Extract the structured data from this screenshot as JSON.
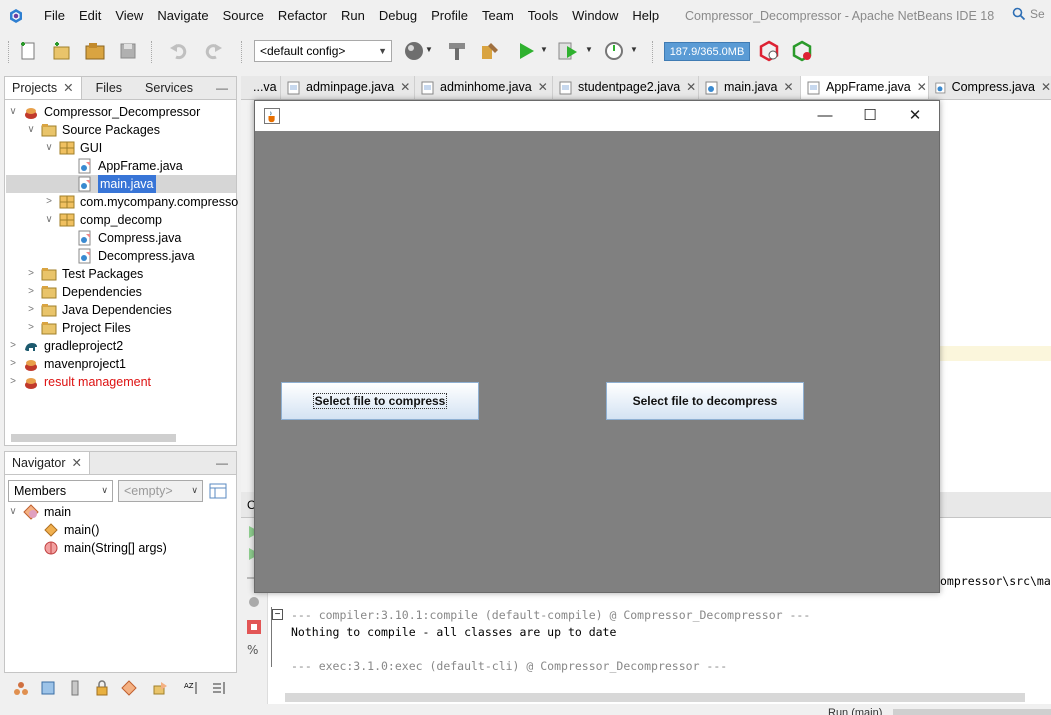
{
  "menubar": {
    "items": [
      "File",
      "Edit",
      "View",
      "Navigate",
      "Source",
      "Refactor",
      "Run",
      "Debug",
      "Profile",
      "Team",
      "Tools",
      "Window",
      "Help"
    ],
    "window_title": "Compressor_Decompressor - Apache NetBeans IDE 18",
    "search_text": "Se"
  },
  "toolbar": {
    "config": "<default config>",
    "memory": "187.9/365.0MB"
  },
  "projects_panel": {
    "tabs": [
      "Projects",
      "Files",
      "Services"
    ],
    "minimize": "—",
    "tree": [
      {
        "label": "Compressor_Decompressor",
        "chev": "∨",
        "icon": "maven-project-icon"
      },
      {
        "label": "Source Packages",
        "chev": "∨",
        "icon": "folder-icon"
      },
      {
        "label": "GUI",
        "chev": "∨",
        "icon": "package-icon"
      },
      {
        "label": "AppFrame.java",
        "chev": "",
        "icon": "java-file-icon"
      },
      {
        "label": "main.java",
        "chev": "",
        "icon": "java-file-icon"
      },
      {
        "label": "com.mycompany.compresso",
        "chev": ">",
        "icon": "package-icon"
      },
      {
        "label": "comp_decomp",
        "chev": "∨",
        "icon": "package-icon"
      },
      {
        "label": "Compress.java",
        "chev": "",
        "icon": "java-file-icon"
      },
      {
        "label": "Decompress.java",
        "chev": "",
        "icon": "java-file-icon"
      },
      {
        "label": "Test Packages",
        "chev": ">",
        "icon": "folder-icon"
      },
      {
        "label": "Dependencies",
        "chev": ">",
        "icon": "folder-icon"
      },
      {
        "label": "Java Dependencies",
        "chev": ">",
        "icon": "folder-icon"
      },
      {
        "label": "Project Files",
        "chev": ">",
        "icon": "folder-icon"
      },
      {
        "label": "gradleproject2",
        "chev": ">",
        "icon": "gradle-icon"
      },
      {
        "label": "mavenproject1",
        "chev": ">",
        "icon": "maven-project-icon"
      },
      {
        "label": "result management",
        "chev": ">",
        "icon": "maven-project-icon"
      }
    ]
  },
  "navigator_panel": {
    "tab": "Navigator",
    "minimize": "—",
    "members_select": "Members",
    "empty_select": "<empty>",
    "tree": [
      {
        "label": "main"
      },
      {
        "label": "main()"
      },
      {
        "label": "main(String[] args)"
      }
    ]
  },
  "editor": {
    "tabs": [
      {
        "label": "...va",
        "close": ""
      },
      {
        "label": "adminpage.java",
        "close": "✕"
      },
      {
        "label": "adminhome.java",
        "close": "✕"
      },
      {
        "label": "studentpage2.java",
        "close": "✕"
      },
      {
        "label": "main.java",
        "close": "✕"
      },
      {
        "label": "AppFrame.java",
        "close": "✕"
      },
      {
        "label": "Compress.java",
        "close": "✕"
      }
    ]
  },
  "output": {
    "partial_path": "ompressor\\src\\mai",
    "partial_o": "O",
    "lines": [
      "--- compiler:3.10.1:compile (default-compile) @ Compressor_Decompressor ---",
      "Nothing to compile - all classes are up to date",
      "--- exec:3.1.0:exec (default-cli) @ Compressor_Decompressor ---"
    ],
    "status": "Run (main)"
  },
  "jframe": {
    "minimize": "—",
    "maximize": "☐",
    "close": "✕",
    "compress_button": "Select file to compress",
    "decompress_button": "Select file to decompress"
  }
}
